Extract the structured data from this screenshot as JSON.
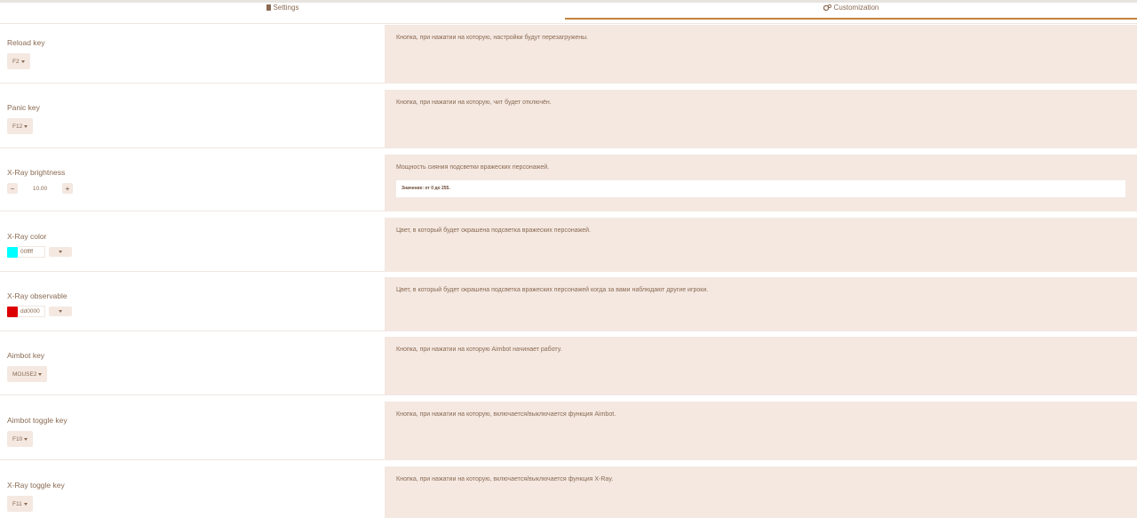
{
  "tabs": [
    {
      "label": "Settings",
      "icon": "file-icon",
      "active": false
    },
    {
      "label": "Customization",
      "icon": "gears-icon",
      "active": true
    }
  ],
  "accent_color": "#c6823f",
  "rows": {
    "reload": {
      "label": "Reload key",
      "value": "F2",
      "desc": "Кнопка, при нажатии на которую, настройки будут перезагружены."
    },
    "panic": {
      "label": "Panic key",
      "value": "F12",
      "desc": "Кнопка, при нажатии на которую, чит будет отключён."
    },
    "brightness": {
      "label": "X-Ray brightness",
      "value": "10.00",
      "minus": "−",
      "plus": "+",
      "desc": "Мощность сияния подсветки вражеских персонажей.",
      "hint": "Значение: от 0 до 255."
    },
    "xray_color": {
      "label": "X-Ray color",
      "value": "00ffff",
      "swatch": "#00ffff",
      "desc": "Цвет, в который будет окрашена подсветка вражеских персонажей."
    },
    "xray_observable": {
      "label": "X-Ray observable",
      "value": "dd0000",
      "swatch": "#dd0000",
      "desc": "Цвет, в который будет окрашена подсветка вражеских персонажей когда за вами наблюдают другие игроки."
    },
    "aimbot_key": {
      "label": "Aimbot key",
      "value": "MOUSE2",
      "desc": "Кнопка, при нажатии на которую Aimbot начинает работу."
    },
    "aimbot_toggle": {
      "label": "Aimbot toggle key",
      "value": "F10",
      "desc": "Кнопка, при нажатии на которую, включается/выключается функция Aimbot."
    },
    "xray_toggle": {
      "label": "X-Ray toggle key",
      "value": "F11",
      "desc": "Кнопка, при нажатии на которую, включается/выключается функция X-Ray."
    }
  }
}
